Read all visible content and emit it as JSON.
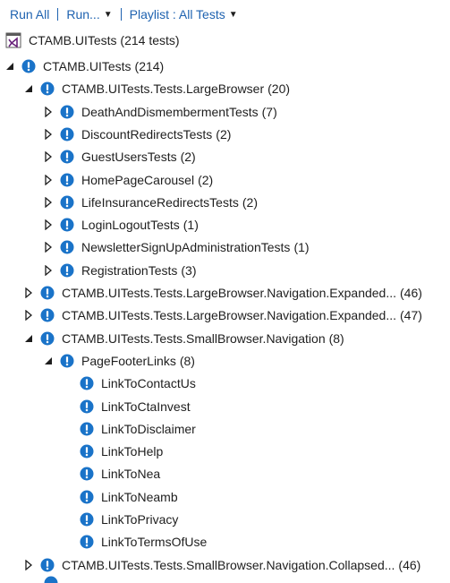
{
  "toolbar": {
    "run_all": "Run All",
    "run": "Run...",
    "playlist": "Playlist : All Tests"
  },
  "header": {
    "project_label": "CTAMB.UITests (214 tests)"
  },
  "colors": {
    "accent": "#1e62b0",
    "info_icon_bg": "#1a73c8",
    "info_icon_fg": "#ffffff",
    "vs_icon": "#68217a"
  },
  "tree": [
    {
      "name": "CTAMB.UITests",
      "count": "(214)",
      "expander": "expanded"
    },
    {
      "name": "CTAMB.UITests.Tests.LargeBrowser",
      "count": "(20)",
      "expander": "expanded"
    },
    {
      "name": "DeathAndDismembermentTests",
      "count": "(7)",
      "expander": "collapsed"
    },
    {
      "name": "DiscountRedirectsTests",
      "count": "(2)",
      "expander": "collapsed"
    },
    {
      "name": "GuestUsersTests",
      "count": "(2)",
      "expander": "collapsed"
    },
    {
      "name": "HomePageCarousel",
      "count": "(2)",
      "expander": "collapsed"
    },
    {
      "name": "LifeInsuranceRedirectsTests",
      "count": "(2)",
      "expander": "collapsed"
    },
    {
      "name": "LoginLogoutTests",
      "count": "(1)",
      "expander": "collapsed"
    },
    {
      "name": "NewsletterSignUpAdministrationTests",
      "count": "(1)",
      "expander": "collapsed"
    },
    {
      "name": "RegistrationTests",
      "count": "(3)",
      "expander": "collapsed"
    },
    {
      "name": "CTAMB.UITests.Tests.LargeBrowser.Navigation.Expanded...",
      "count": "(46)",
      "expander": "collapsed"
    },
    {
      "name": "CTAMB.UITests.Tests.LargeBrowser.Navigation.Expanded...",
      "count": "(47)",
      "expander": "collapsed"
    },
    {
      "name": "CTAMB.UITests.Tests.SmallBrowser.Navigation",
      "count": "(8)",
      "expander": "expanded"
    },
    {
      "name": "PageFooterLinks",
      "count": "(8)",
      "expander": "expanded"
    },
    {
      "name": "LinkToContactUs",
      "count": "",
      "expander": "none"
    },
    {
      "name": "LinkToCtaInvest",
      "count": "",
      "expander": "none"
    },
    {
      "name": "LinkToDisclaimer",
      "count": "",
      "expander": "none"
    },
    {
      "name": "LinkToHelp",
      "count": "",
      "expander": "none"
    },
    {
      "name": "LinkToNea",
      "count": "",
      "expander": "none"
    },
    {
      "name": "LinkToNeamb",
      "count": "",
      "expander": "none"
    },
    {
      "name": "LinkToPrivacy",
      "count": "",
      "expander": "none"
    },
    {
      "name": "LinkToTermsOfUse",
      "count": "",
      "expander": "none"
    },
    {
      "name": "CTAMB.UITests.Tests.SmallBrowser.Navigation.Collapsed...",
      "count": "(46)",
      "expander": "collapsed"
    }
  ]
}
